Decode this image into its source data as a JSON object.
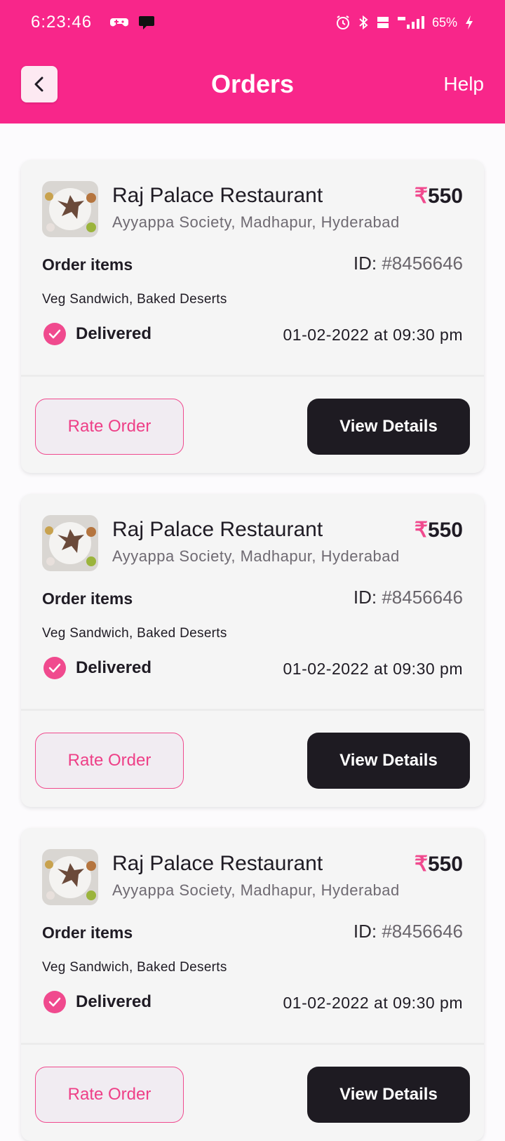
{
  "status_bar": {
    "time": "6:23:46",
    "battery": "65%"
  },
  "header": {
    "title": "Orders",
    "help": "Help"
  },
  "orders": [
    {
      "restaurant": "Raj Palace Restaurant",
      "price_symbol": "₹",
      "price": "550",
      "address": "Ayyappa Society, Madhapur, Hyderabad",
      "items_label": "Order items",
      "id_label": "ID:",
      "id_value": "#8456646",
      "items": "Veg Sandwich, Baked Deserts",
      "status": "Delivered",
      "date": "01-02-2022 at 09:30 pm",
      "rate_label": "Rate Order",
      "view_label": "View Details"
    },
    {
      "restaurant": "Raj Palace Restaurant",
      "price_symbol": "₹",
      "price": "550",
      "address": "Ayyappa Society, Madhapur, Hyderabad",
      "items_label": "Order items",
      "id_label": "ID:",
      "id_value": "#8456646",
      "items": "Veg Sandwich, Baked Deserts",
      "status": "Delivered",
      "date": "01-02-2022 at 09:30 pm",
      "rate_label": "Rate Order",
      "view_label": "View Details"
    },
    {
      "restaurant": "Raj Palace Restaurant",
      "price_symbol": "₹",
      "price": "550",
      "address": "Ayyappa Society, Madhapur, Hyderabad",
      "items_label": "Order items",
      "id_label": "ID:",
      "id_value": "#8456646",
      "items": "Veg Sandwich, Baked Deserts",
      "status": "Delivered",
      "date": "01-02-2022 at 09:30 pm",
      "rate_label": "Rate Order",
      "view_label": "View Details"
    }
  ],
  "colors": {
    "brand": "#f8268a",
    "accent": "#f04a8e",
    "dark_button": "#1e1b22"
  },
  "icons": [
    "back-arrow-icon",
    "check-circle-icon",
    "alarm-icon",
    "bluetooth-icon",
    "signal-icon",
    "battery-icon"
  ]
}
